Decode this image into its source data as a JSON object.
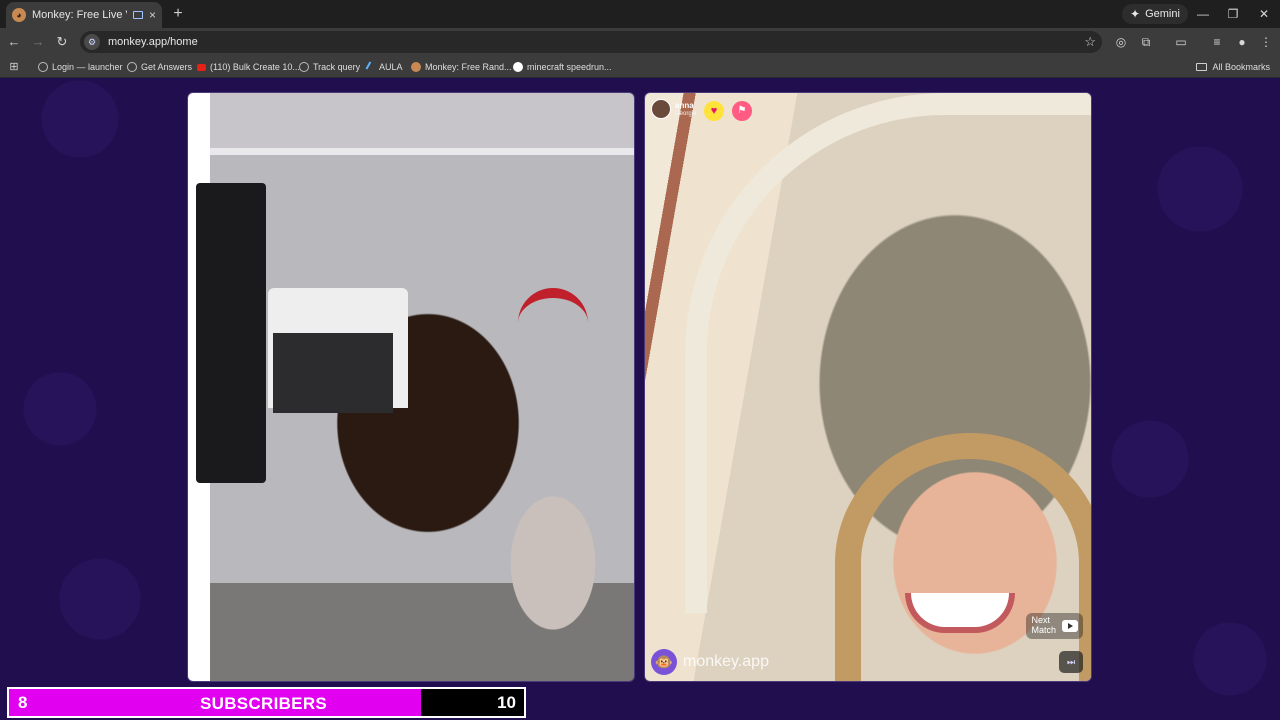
{
  "browser": {
    "tab": {
      "title": "Monkey: Free Live Video Ch",
      "close": "×"
    },
    "new_tab": "+",
    "gemini_label": "Gemini",
    "window_controls": {
      "minimize": "—",
      "restore": "❐",
      "close": "✕"
    },
    "url": "monkey.app/home",
    "bookmarks": [
      {
        "label": "Login — launcher",
        "icon": "globe-icon"
      },
      {
        "label": "Get Answers",
        "icon": "globe-icon"
      },
      {
        "label": "(110) Bulk Create 10...",
        "icon": "youtube-icon"
      },
      {
        "label": "Track query",
        "icon": "globe-icon"
      },
      {
        "label": "AULA",
        "icon": "aula-icon"
      },
      {
        "label": "Monkey: Free Rand...",
        "icon": "monkey-icon"
      },
      {
        "label": "minecraft speedrun...",
        "icon": "google-icon"
      }
    ],
    "all_bookmarks": "All Bookmarks"
  },
  "call": {
    "remote_user": {
      "name": "anna",
      "location": "Georgia"
    },
    "brand": "monkey.app",
    "next_match": {
      "line1": "Next",
      "line2": "Match"
    },
    "skip_icon": "⏭"
  },
  "subscriber_goal": {
    "current": "8",
    "label": "SUBSCRIBERS",
    "goal": "10",
    "progress_fraction": 0.8,
    "fill_color": "#e100f0"
  }
}
